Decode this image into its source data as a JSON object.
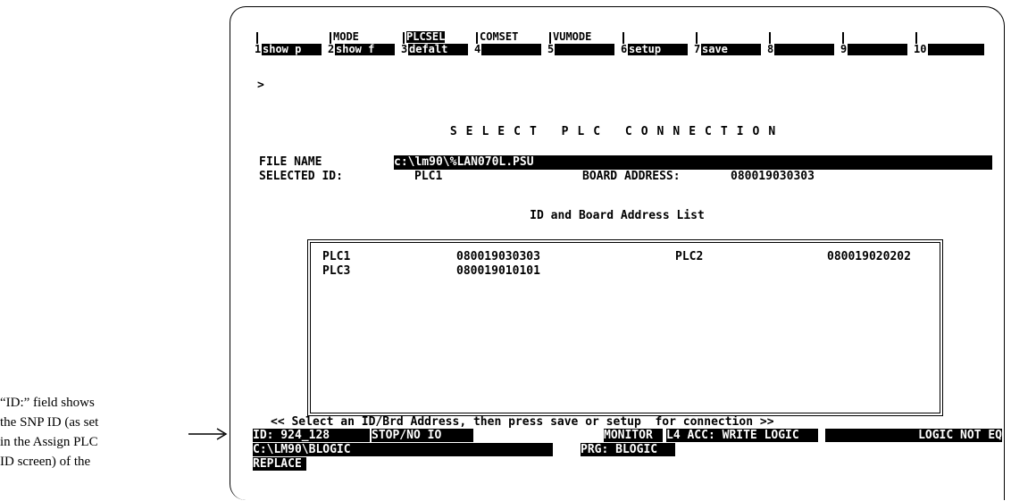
{
  "caption": {
    "lines": [
      "“ID:” field shows",
      "the SNP ID (as set",
      "in the Assign PLC",
      "ID screen) of the"
    ]
  },
  "menu": [
    {
      "num": "1",
      "top": "",
      "label": "show p"
    },
    {
      "num": "2",
      "top": "MODE",
      "label": "show f"
    },
    {
      "num": "3",
      "top": "PLCSEL",
      "label": "defalt"
    },
    {
      "num": "4",
      "top": "COMSET",
      "label": ""
    },
    {
      "num": "5",
      "top": "VUMODE",
      "label": ""
    },
    {
      "num": "6",
      "top": "",
      "label": "setup"
    },
    {
      "num": "7",
      "top": "",
      "label": "save"
    },
    {
      "num": "8",
      "top": "",
      "label": ""
    },
    {
      "num": "9",
      "top": "",
      "label": ""
    },
    {
      "num": "10",
      "top": "",
      "label": ""
    }
  ],
  "prompt": ">",
  "title": "SELECT PLC CONNECTION",
  "file": {
    "label": "FILE NAME",
    "value": "c:\\lm90\\%LAN070L.PSU"
  },
  "selected": {
    "id_label": "SELECTED ID:",
    "id_value": "PLC1",
    "board_label": "BOARD ADDRESS:",
    "board_value": "080019030303"
  },
  "list": {
    "heading": "ID and Board Address List",
    "rows": [
      {
        "id1": "PLC1",
        "addr1": "080019030303",
        "id2": "PLC2",
        "addr2": "080019020202"
      },
      {
        "id1": "PLC3",
        "addr1": "080019010101",
        "id2": "",
        "addr2": ""
      }
    ]
  },
  "instruction": "<< Select an ID/Brd Address, then press save or setup  for connection >>",
  "status": {
    "id": "ID: 924_128",
    "mode": "STOP/NO IO",
    "monitor": "MONITOR",
    "access": "L4 ACC: WRITE LOGIC",
    "logic": "LOGIC NOT EQ",
    "path": "C:\\LM90\\BLOGIC",
    "program": "PRG: BLOGIC",
    "replace": "REPLACE"
  }
}
